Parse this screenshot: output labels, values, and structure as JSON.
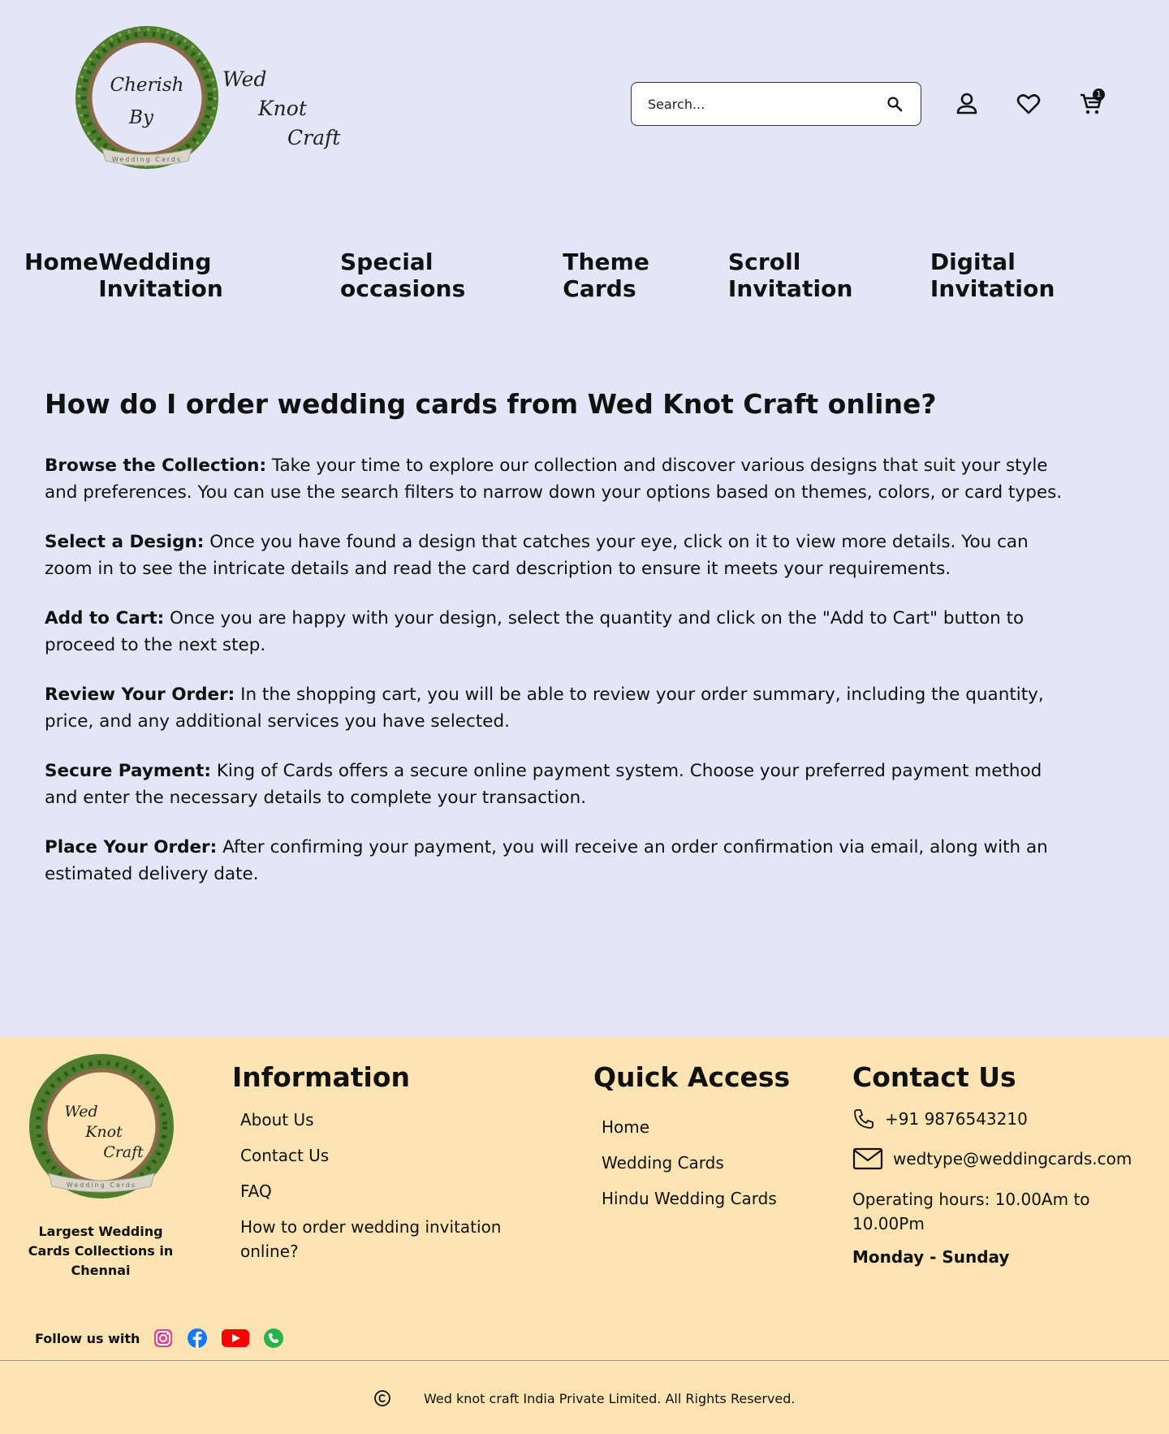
{
  "logo": {
    "line1": "Cherish",
    "line2": "By",
    "ribbon": "Wedding Cards",
    "wed": "Wed",
    "knot": "Knot",
    "craft": "Craft"
  },
  "header": {
    "search_placeholder": "Search...",
    "cart_count": "1"
  },
  "nav": [
    "Home",
    "Wedding Invitation",
    "Special occasions",
    "Theme Cards",
    "Scroll Invitation",
    "Digital Invitation"
  ],
  "main": {
    "title": "How do I order wedding cards from Wed Knot Craft online?",
    "steps": [
      {
        "label": "Browse the Collection:",
        "text": " Take your time to explore our collection and discover various designs that suit your style and preferences. You can use the search filters to narrow down your options based on themes, colors, or card types."
      },
      {
        "label": "Select a Design:",
        "text": " Once you have found a design that catches your eye, click on it to view more details. You can zoom in to see the intricate details and read the card description to ensure it meets your requirements."
      },
      {
        "label": "Add to Cart:",
        "text": " Once you are happy with your design, select the quantity and click on the \"Add to Cart\" button to proceed to the next step."
      },
      {
        "label": "Review Your Order:",
        "text": " In the shopping cart, you will be able to review your order summary, including the quantity, price, and any additional services you have selected."
      },
      {
        "label": "Secure Payment:",
        "text": " King of Cards offers a secure online payment system. Choose your preferred payment method and enter the necessary details to complete your transaction."
      },
      {
        "label": "Place Your Order:",
        "text": " After confirming your payment, you will receive an order confirmation via email, along with an estimated delivery date."
      }
    ]
  },
  "footer": {
    "tagline": "Largest Wedding Cards Collections in Chennai",
    "information": {
      "title": "Information",
      "links": [
        "About Us",
        "Contact Us",
        "FAQ",
        "How to order wedding invitation online?"
      ]
    },
    "quick_access": {
      "title": "Quick Access",
      "links": [
        "Home",
        "Wedding Cards",
        "Hindu Wedding Cards"
      ]
    },
    "contact": {
      "title": "Contact Us",
      "phone": "+91 9876543210",
      "email": "wedtype@weddingcards.com",
      "hours": "Operating hours: 10.00Am to 10.00Pm",
      "days": "Monday  - Sunday"
    },
    "follow_label": "Follow us with",
    "social_icons": [
      "instagram-icon",
      "facebook-icon",
      "youtube-icon",
      "whatsapp-icon"
    ],
    "copyright": "Wed knot craft India Private Limited. All Rights Reserved."
  },
  "colors": {
    "page_bg": "#e4e5f7",
    "footer_bg": "#fde4b2",
    "text": "#111111"
  }
}
